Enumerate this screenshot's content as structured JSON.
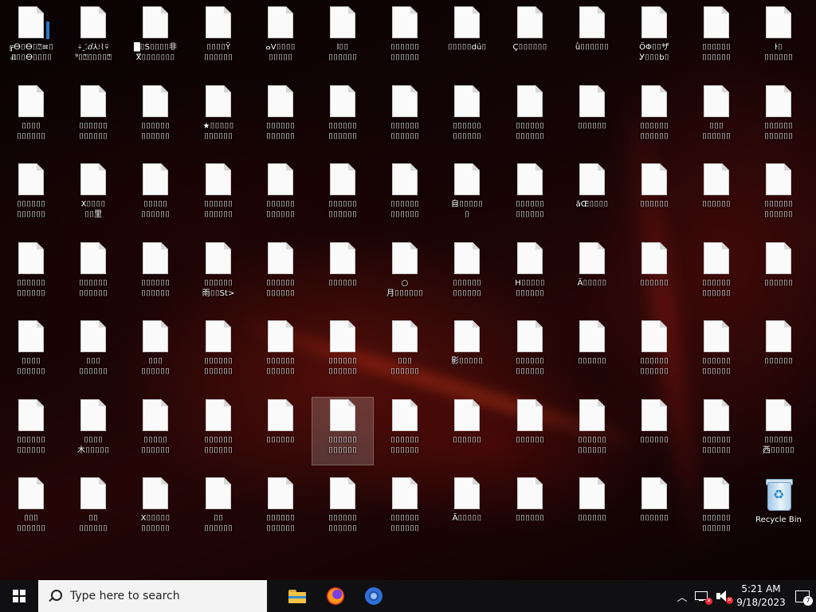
{
  "desktop": {
    "icons": [
      [
        "╔ⴱ⌷ⴱ⌷⍰≡⌷",
        "Ⱊ⌷⌷ⴱ⌷⌷⌷⌷"
      ],
      [
        "⍭ꞈ⁚ⅆ⅄⁝⌇⍫",
        "⁹⌷⍰⌷⌷⌷⌷⍰"
      ],
      [
        "█⌷S⌷⌷⌷⌷非",
        "ⴳ⌷⌷⌷⌷⌷⌷⌷"
      ],
      [
        "⌷⌷⌷⌷Ÿ",
        "⌷⌷⌷⌷⌷⌷"
      ],
      [
        "ⴰⅤ⌷⌷⌷⌷",
        "⌷⌷⌷⌷⌷"
      ],
      [
        "ⅼ⌷⌷",
        "⌷⌷⌷⌷⌷⌷"
      ],
      [
        "⌷⌷⌷⌷⌷⌷",
        "⌷⌷⌷⌷⌷⌷"
      ],
      [
        "⌷⌷⌷⌷⌷dú⌷",
        ""
      ],
      [
        "Ç⌷⌷⌷⌷⌷⌷",
        ""
      ],
      [
        "ǜ⌷⌷⌷⌷⌷⌷",
        ""
      ],
      [
        "ŐΦ⌷⌷ザ",
        "Ꭹ⌷⌷⌷b⌷"
      ],
      [
        "⌷⌷⌷⌷⌷⌷",
        "⌷⌷⌷⌷⌷⌷"
      ],
      [
        "ŀ⌷",
        "⌷⌷⌷⌷⌷⌷"
      ],
      [
        "⌷⌷⌷⌷",
        "⌷⌷⌷⌷⌷⌷"
      ],
      [
        "⌷⌷⌷⌷⌷⌷",
        "⌷⌷⌷⌷⌷⌷"
      ],
      [
        "⌷⌷⌷⌷⌷⌷",
        "⌷⌷⌷⌷⌷⌷"
      ],
      [
        "★⌷⌷⌷⌷⌷",
        "⌷⌷⌷⌷⌷⌷"
      ],
      [
        "⌷⌷⌷⌷⌷⌷",
        "⌷⌷⌷⌷⌷⌷"
      ],
      [
        "⌷⌷⌷⌷⌷⌷",
        "⌷⌷⌷⌷⌷⌷"
      ],
      [
        "⌷⌷⌷⌷⌷⌷",
        "⌷⌷⌷⌷⌷⌷"
      ],
      [
        "⌷⌷⌷⌷⌷⌷",
        "⌷⌷⌷⌷⌷⌷"
      ],
      [
        "⌷⌷⌷⌷⌷⌷",
        "⌷⌷⌷⌷⌷⌷"
      ],
      [
        "⌷⌷⌷⌷⌷⌷",
        ""
      ],
      [
        "⌷⌷⌷⌷⌷⌷",
        "⌷⌷⌷⌷⌷⌷"
      ],
      [
        "⌷⌷⌷",
        "⌷⌷⌷⌷⌷⌷"
      ],
      [
        "⌷⌷⌷⌷⌷⌷",
        "⌷⌷⌷⌷⌷⌷"
      ],
      [
        "⌷⌷⌷⌷⌷⌷",
        "⌷⌷⌷⌷⌷⌷"
      ],
      [
        "X⌷⌷⌷⌷",
        "⌷⌷里"
      ],
      [
        "⌷⌷⌷⌷⌷",
        "⌷⌷⌷⌷⌷⌷"
      ],
      [
        "⌷⌷⌷⌷⌷⌷",
        "⌷⌷⌷⌷⌷⌷"
      ],
      [
        "⌷⌷⌷⌷⌷⌷",
        "⌷⌷⌷⌷⌷⌷"
      ],
      [
        "⌷⌷⌷⌷⌷⌷",
        "⌷⌷⌷⌷⌷⌷"
      ],
      [
        "⌷⌷⌷⌷⌷⌷",
        "⌷⌷⌷⌷⌷⌷"
      ],
      [
        "自⌷⌷⌷⌷⌷",
        "⌷"
      ],
      [
        "⌷⌷⌷⌷⌷⌷",
        "⌷⌷⌷⌷⌷⌷"
      ],
      [
        "ăŒ⌷⌷⌷⌷",
        ""
      ],
      [
        "⌷⌷⌷⌷⌷⌷",
        ""
      ],
      [
        "⌷⌷⌷⌷⌷⌷",
        ""
      ],
      [
        "⌷⌷⌷⌷⌷⌷",
        "⌷⌷⌷⌷⌷⌷"
      ],
      [
        "⌷⌷⌷⌷⌷⌷",
        "⌷⌷⌷⌷⌷⌷"
      ],
      [
        "⌷⌷⌷⌷⌷⌷",
        "⌷⌷⌷⌷⌷⌷"
      ],
      [
        "⌷⌷⌷⌷⌷⌷",
        "⌷⌷⌷⌷⌷⌷"
      ],
      [
        "⌷⌷⌷⌷⌷⌷",
        "雨⌷⌷St>"
      ],
      [
        "⌷⌷⌷⌷⌷⌷",
        "⌷⌷⌷⌷⌷⌷"
      ],
      [
        "⌷⌷⌷⌷⌷⌷",
        ""
      ],
      [
        "○",
        "月⌷⌷⌷⌷⌷⌷"
      ],
      [
        "⌷⌷⌷⌷⌷⌷",
        "⌷⌷⌷⌷⌷⌷"
      ],
      [
        "H⌷⌷⌷⌷⌷",
        "⌷⌷⌷⌷⌷⌷"
      ],
      [
        "Ä⌷⌷⌷⌷⌷",
        ""
      ],
      [
        "⌷⌷⌷⌷⌷⌷",
        ""
      ],
      [
        "⌷⌷⌷⌷⌷⌷",
        "⌷⌷⌷⌷⌷⌷"
      ],
      [
        "⌷⌷⌷⌷⌷⌷",
        ""
      ],
      [
        "⌷⌷⌷⌷",
        "⌷⌷⌷⌷⌷⌷"
      ],
      [
        "⌷⌷⌷",
        "⌷⌷⌷⌷⌷⌷"
      ],
      [
        "⌷⌷⌷",
        "⌷⌷⌷⌷⌷⌷"
      ],
      [
        "⌷⌷⌷⌷⌷⌷",
        "⌷⌷⌷⌷⌷⌷"
      ],
      [
        "⌷⌷⌷⌷⌷⌷",
        "⌷⌷⌷⌷⌷⌷"
      ],
      [
        "⌷⌷⌷⌷⌷⌷",
        "⌷⌷⌷⌷⌷⌷"
      ],
      [
        "⌷⌷⌷",
        "⌷⌷⌷⌷⌷⌷"
      ],
      [
        "影⌷⌷⌷⌷⌷",
        ""
      ],
      [
        "⌷⌷⌷⌷⌷⌷",
        "⌷⌷⌷⌷⌷⌷"
      ],
      [
        "⌷⌷⌷⌷⌷⌷",
        ""
      ],
      [
        "⌷⌷⌷⌷⌷⌷",
        "⌷⌷⌷⌷⌷⌷"
      ],
      [
        "⌷⌷⌷⌷⌷⌷",
        "⌷⌷⌷⌷⌷⌷"
      ],
      [
        "⌷⌷⌷⌷⌷⌷",
        ""
      ],
      [
        "⌷⌷⌷⌷⌷⌷",
        "⌷⌷⌷⌷⌷⌷"
      ],
      [
        "⌷⌷⌷⌷",
        "木⌷⌷⌷⌷⌷"
      ],
      [
        "⌷⌷⌷⌷⌷",
        "⌷⌷⌷⌷⌷⌷"
      ],
      [
        "⌷⌷⌷⌷⌷⌷",
        "⌷⌷⌷⌷⌷⌷"
      ],
      [
        "⌷⌷⌷⌷⌷⌷",
        ""
      ],
      [
        "⌷⌷⌷⌷⌷⌷",
        "⌷⌷⌷⌷⌷⌷"
      ],
      [
        "⌷⌷⌷⌷⌷⌷",
        "⌷⌷⌷⌷⌷⌷"
      ],
      [
        "⌷⌷⌷⌷⌷⌷",
        ""
      ],
      [
        "⌷⌷⌷⌷⌷⌷",
        ""
      ],
      [
        "⌷⌷⌷⌷⌷⌷",
        "⌷⌷⌷⌷⌷⌷"
      ],
      [
        "⌷⌷⌷⌷⌷⌷",
        ""
      ],
      [
        "⌷⌷⌷⌷⌷⌷",
        "⌷⌷⌷⌷⌷⌷"
      ],
      [
        "⌷⌷⌷⌷⌷⌷",
        "西⌷⌷⌷⌷⌷"
      ],
      [
        "⌷⌷⌷",
        "⌷⌷⌷⌷⌷⌷"
      ],
      [
        "⌷⌷",
        "⌷⌷⌷⌷⌷⌷"
      ],
      [
        "X⌷⌷⌷⌷⌷",
        "⌷⌷⌷⌷⌷⌷"
      ],
      [
        "⌷⌷",
        "⌷⌷⌷⌷⌷⌷"
      ],
      [
        "⌷⌷⌷⌷⌷⌷",
        "⌷⌷⌷⌷⌷⌷"
      ],
      [
        "⌷⌷⌷⌷⌷⌷",
        "⌷⌷⌷⌷⌷⌷"
      ],
      [
        "⌷⌷⌷⌷⌷⌷",
        "⌷⌷⌷⌷⌷⌷"
      ],
      [
        "Ã⌷⌷⌷⌷⌷",
        ""
      ],
      [
        "⌷⌷⌷⌷⌷⌷",
        ""
      ],
      [
        "⌷⌷⌷⌷⌷⌷",
        ""
      ],
      [
        "⌷⌷⌷⌷⌷⌷",
        ""
      ],
      [
        "⌷⌷⌷⌷⌷⌷",
        "⌷⌷⌷⌷⌷⌷"
      ],
      [
        "Recycle Bin",
        ""
      ]
    ]
  },
  "taskbar": {
    "search_placeholder": "Type here to search",
    "time": "5:21 AM",
    "date": "9/18/2023",
    "notification_count": "7"
  }
}
